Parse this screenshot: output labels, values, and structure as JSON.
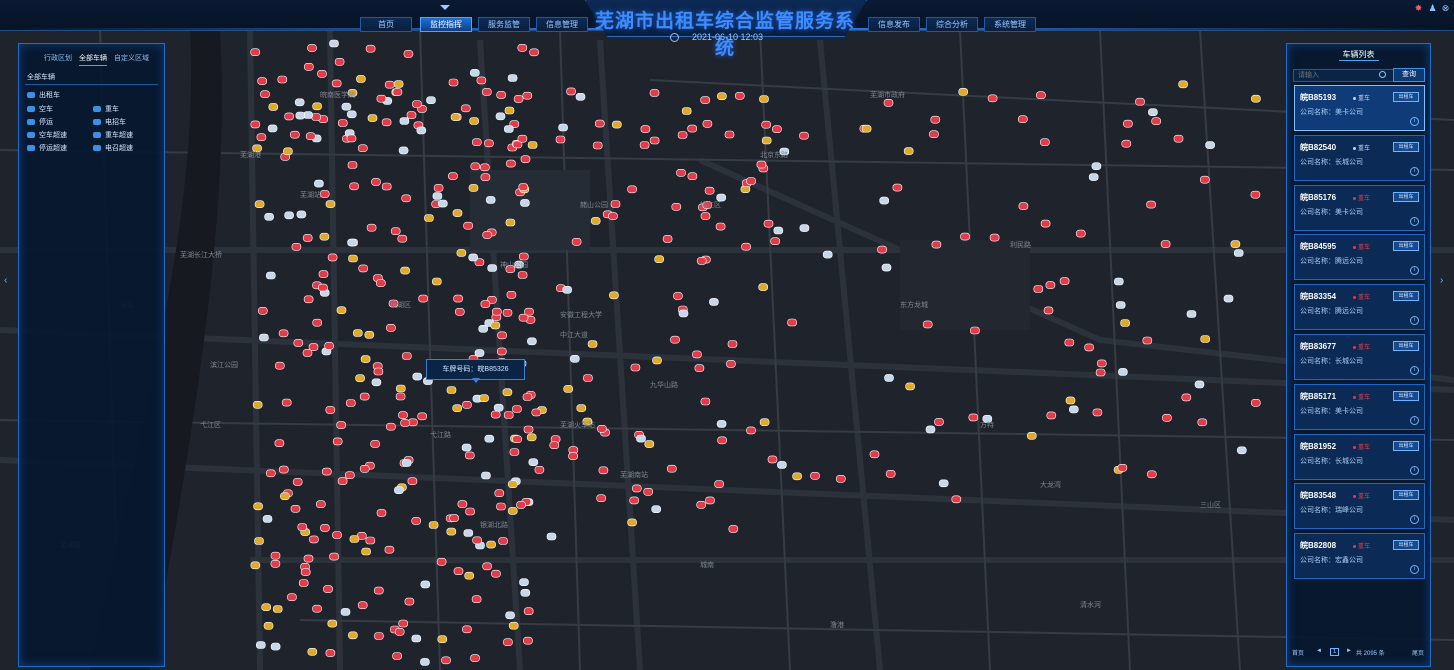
{
  "header": {
    "title": "芜湖市出租车综合监管服务系统",
    "datetime": "2021-06-10 12:03",
    "nav_left": [
      "首页",
      "监控指挥",
      "服务监管",
      "信息管理"
    ],
    "nav_right": [
      "信息发布",
      "综合分析",
      "系统管理"
    ],
    "active_nav": "监控指挥"
  },
  "left_panel": {
    "tabs": [
      "行政区划",
      "全部车辆",
      "自定义区域"
    ],
    "active_tab": "全部车辆",
    "section_title": "全部车辆",
    "tree_root": "出租车",
    "legend": [
      {
        "label": "空车",
        "icon": "car-icon"
      },
      {
        "label": "重车",
        "icon": "car-icon"
      },
      {
        "label": "停运",
        "icon": "car-icon"
      },
      {
        "label": "电招车",
        "icon": "car-icon"
      },
      {
        "label": "空车超速",
        "icon": "car-icon"
      },
      {
        "label": "重车超速",
        "icon": "car-icon"
      },
      {
        "label": "停运超速",
        "icon": "car-icon"
      },
      {
        "label": "电召超速",
        "icon": "car-icon"
      }
    ]
  },
  "map": {
    "tooltip": "车牌号码：皖B85326",
    "labels": [
      "芜湖县",
      "弋江区",
      "镜湖区",
      "鸠江区",
      "芜湖长江大桥",
      "芜湖南站",
      "神山公园",
      "中江大道",
      "九华山路",
      "长江",
      "芜湖站",
      "赭山公园",
      "弋江路",
      "银湖北路",
      "北京东路",
      "东方龙城",
      "利民路",
      "滨江公园",
      "芜湖港",
      "安徽工程大学",
      "皖南医学院",
      "方特",
      "三山区",
      "芜湖市政府",
      "芜湖火车站",
      "大龙湾",
      "城南",
      "澛港",
      "清水河"
    ]
  },
  "right_panel": {
    "title": "车辆列表",
    "search_placeholder": "请输入",
    "query_label": "查询",
    "company_prefix": "公司名称：",
    "tag_label": "出租车",
    "vehicles": [
      {
        "plate": "皖B85193",
        "status": "重车",
        "company": "美卡公司"
      },
      {
        "plate": "皖B82540",
        "status": "重车",
        "company": "长城公司"
      },
      {
        "plate": "皖B85176",
        "status": "重车",
        "company": "美卡公司"
      },
      {
        "plate": "皖B84595",
        "status": "重车",
        "company": "腾远公司"
      },
      {
        "plate": "皖B83354",
        "status": "重车",
        "company": "腾远公司"
      },
      {
        "plate": "皖B83677",
        "status": "重车",
        "company": "长城公司"
      },
      {
        "plate": "皖B85171",
        "status": "重车",
        "company": "美卡公司"
      },
      {
        "plate": "皖B81952",
        "status": "重车",
        "company": "长城公司"
      },
      {
        "plate": "皖B83548",
        "status": "重车",
        "company": "瑞峰公司"
      },
      {
        "plate": "皖B82808",
        "status": "重车",
        "company": "宏鑫公司"
      }
    ],
    "pager": {
      "first": "首页",
      "prev": "◄",
      "current": "1",
      "next": "►",
      "total": "共 2095 条",
      "last": "尾页"
    }
  },
  "colors": {
    "accent": "#2f86ff",
    "occupied": "#e23c4b",
    "empty": "#c7d7ea",
    "stopped": "#e0a92a"
  }
}
